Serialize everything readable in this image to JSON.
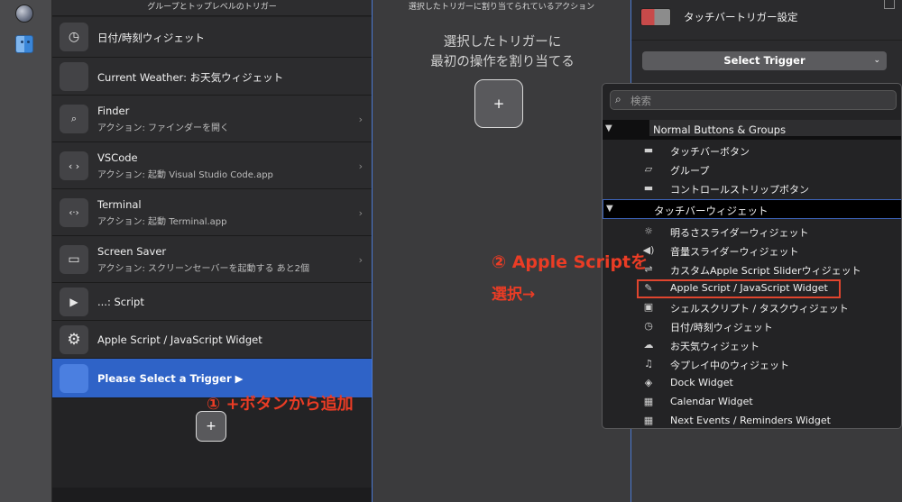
{
  "left_panel": {
    "header": "グループとトップレベルのトリガー",
    "items": [
      {
        "icon": "clock-icon",
        "glyph": "◷",
        "title": "日付/時刻ウィジェット",
        "subtitle": ""
      },
      {
        "icon": "weather-icon",
        "glyph": "",
        "title": "Current Weather: お天気ウィジェット",
        "subtitle": ""
      },
      {
        "icon": "finder-folder-icon",
        "glyph": "⌕",
        "title": "Finder",
        "subtitle": "アクション: ファインダーを開く",
        "chevron": "›"
      },
      {
        "icon": "code-icon",
        "glyph": "‹ ›",
        "title": "VSCode",
        "subtitle": "アクション: 起動 Visual Studio Code.app",
        "chevron": "›"
      },
      {
        "icon": "terminal-icon",
        "glyph": "‹·›",
        "title": "Terminal",
        "subtitle": "アクション: 起動 Terminal.app",
        "chevron": "›"
      },
      {
        "icon": "monitor-icon",
        "glyph": "▭",
        "title": "Screen Saver",
        "subtitle": "アクション: スクリーンセーバーを起動する あと2個",
        "chevron": "›"
      },
      {
        "icon": "youtube-icon",
        "glyph": "▶",
        "title": "...: Script",
        "subtitle": ""
      },
      {
        "icon": "gear-icon",
        "glyph": "⚙",
        "title": "Apple Script / JavaScript Widget",
        "subtitle": ""
      },
      {
        "icon": "blank-icon",
        "glyph": "",
        "title": "Please Select a Trigger ▶",
        "subtitle": ""
      }
    ],
    "add_button": "+"
  },
  "middle_panel": {
    "header": "選択したトリガーに割り当てられているアクション",
    "message_line1": "選択したトリガーに",
    "message_line2": "最初の操作を割り当てる",
    "add_button": "+"
  },
  "right_panel": {
    "title": "タッチバートリガー設定",
    "select_label": "Select Trigger",
    "select_caret": "⌄"
  },
  "trigger_popup": {
    "search_placeholder": "検索",
    "groups": [
      {
        "label": "Normal Buttons & Groups",
        "items": [
          {
            "icon": "touchbar-button-icon",
            "glyph": "▬",
            "label": "タッチバーボタン"
          },
          {
            "icon": "folder-icon",
            "glyph": "▱",
            "label": "グループ"
          },
          {
            "icon": "control-strip-icon",
            "glyph": "▬",
            "label": "コントロールストリップボタン"
          }
        ]
      },
      {
        "label": "タッチバーウィジェット",
        "items": [
          {
            "icon": "brightness-icon",
            "glyph": "☼",
            "label": "明るさスライダーウィジェット"
          },
          {
            "icon": "volume-icon",
            "glyph": "◀)",
            "label": "音量スライダーウィジェット"
          },
          {
            "icon": "slider-icon",
            "glyph": "⇌",
            "label": "カスタムApple Script Sliderウィジェット"
          },
          {
            "icon": "script-icon",
            "glyph": "✎",
            "label": "Apple Script / JavaScript Widget"
          },
          {
            "icon": "shell-icon",
            "glyph": "▣",
            "label": "シェルスクリプト / タスクウィジェット"
          },
          {
            "icon": "clock-icon",
            "glyph": "◷",
            "label": "日付/時刻ウィジェット"
          },
          {
            "icon": "cloud-icon",
            "glyph": "☁",
            "label": "お天気ウィジェット"
          },
          {
            "icon": "music-icon",
            "glyph": "♫",
            "label": "今プレイ中のウィジェット"
          },
          {
            "icon": "dock-icon",
            "glyph": "◈",
            "label": "Dock Widget"
          },
          {
            "icon": "calendar-icon",
            "glyph": "▦",
            "label": "Calendar Widget"
          },
          {
            "icon": "events-icon",
            "glyph": "▦",
            "label": "Next Events / Reminders Widget"
          }
        ]
      }
    ]
  },
  "annotations": {
    "step1": "① +ボタンから追加",
    "step2_line1": "② Apple Scriptを",
    "step2_line2": "選択→",
    "color": "#ea3c25"
  },
  "colors": {
    "selection": "#2f63c7",
    "highlight_box": "#e0452e"
  }
}
